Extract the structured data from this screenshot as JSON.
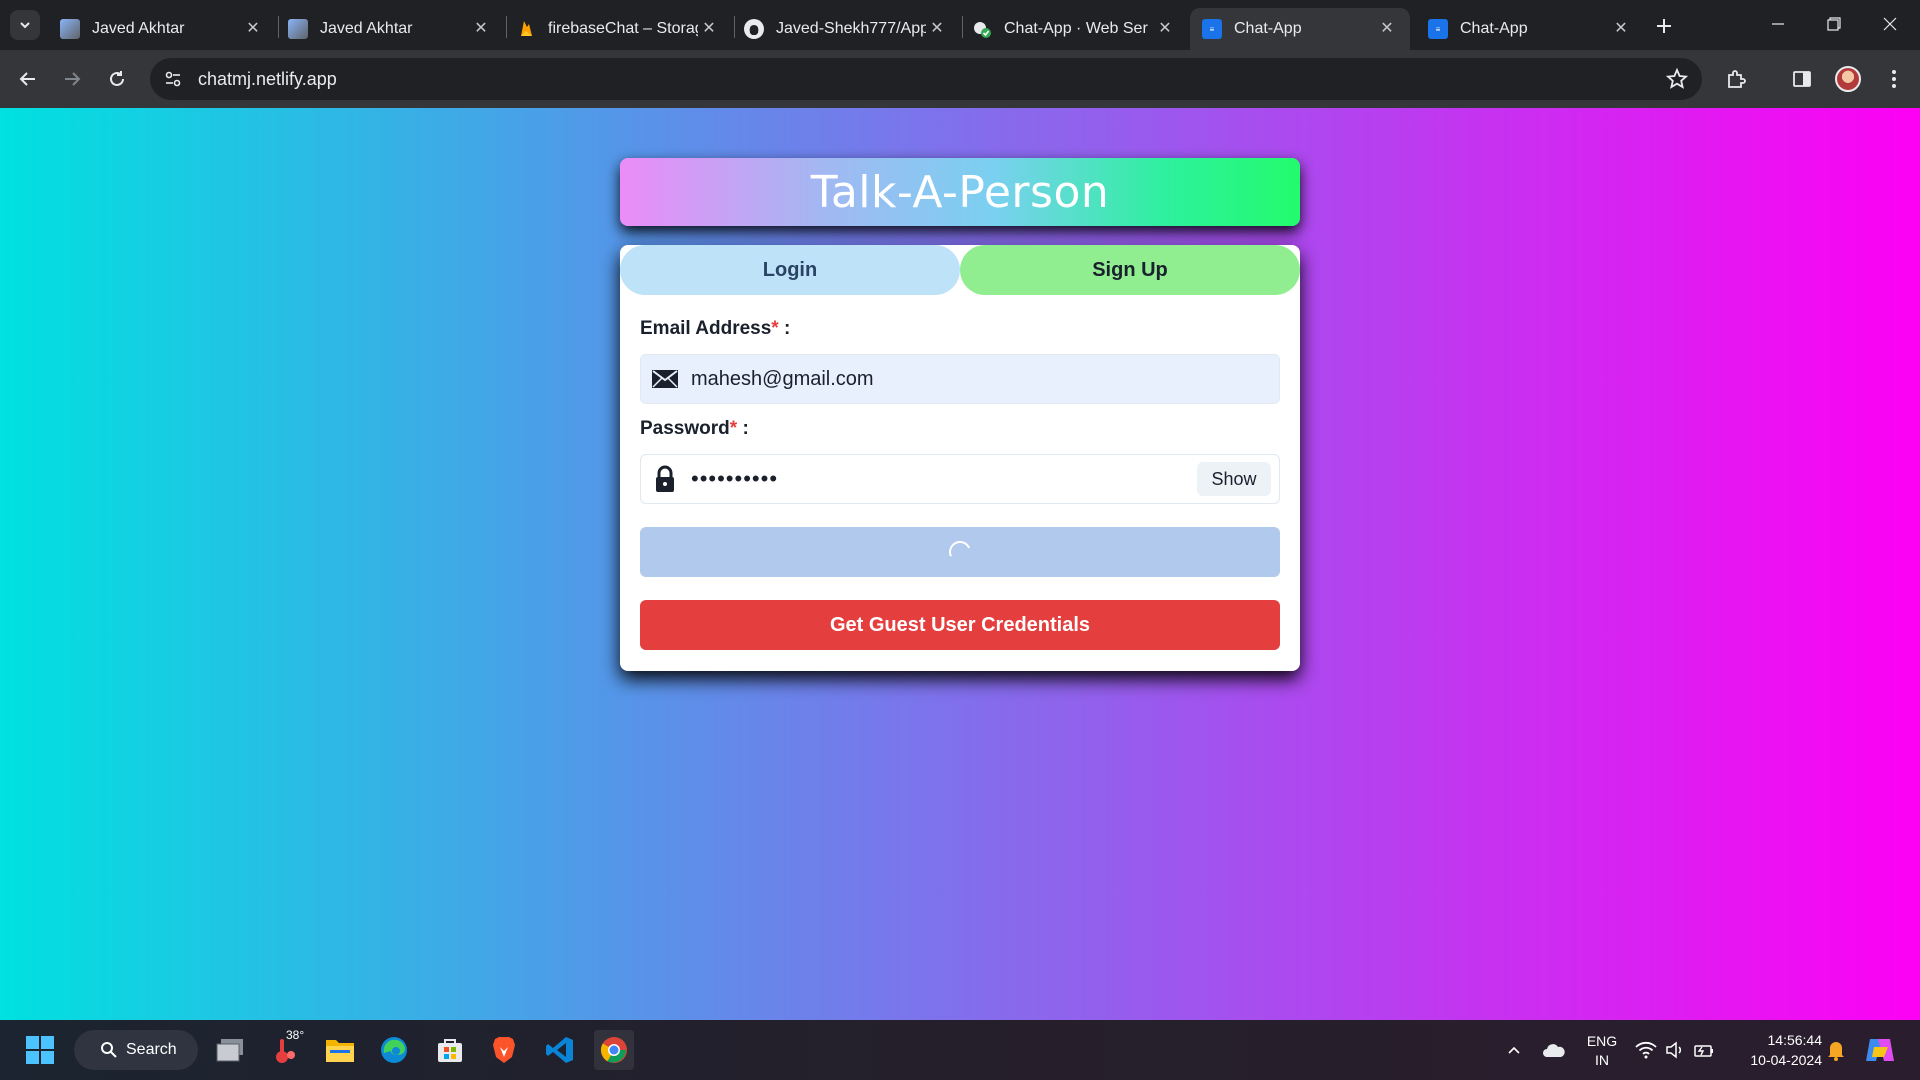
{
  "browser": {
    "tabs": [
      {
        "title": "Javed Akhtar",
        "favicon": "person-avatar-icon",
        "active": false
      },
      {
        "title": "Javed Akhtar",
        "favicon": "person-avatar-icon",
        "active": false
      },
      {
        "title": "firebaseChat – Storag",
        "favicon": "firebase-icon",
        "active": false
      },
      {
        "title": "Javed-Shekh777/App",
        "favicon": "github-icon",
        "active": false
      },
      {
        "title": "Chat-App · Web Ser",
        "favicon": "render-icon",
        "active": false
      },
      {
        "title": "Chat-App",
        "favicon": "chat-app-icon",
        "active": true
      },
      {
        "title": "Chat-App",
        "favicon": "chat-app-icon",
        "active": false
      }
    ],
    "url": "chatmj.netlify.app"
  },
  "app": {
    "title": "Talk-A-Person",
    "tabs": {
      "login": "Login",
      "signup": "Sign Up"
    },
    "email": {
      "label": "Email Address",
      "required_mark": "*",
      "suffix": " :",
      "value": "mahesh@gmail.com"
    },
    "password": {
      "label": "Password",
      "required_mark": "*",
      "suffix": " :",
      "value": "••••••••••",
      "toggle": "Show"
    },
    "submit": {
      "state": "loading"
    },
    "guest_button": "Get Guest User Credentials"
  },
  "taskbar": {
    "search_label": "Search",
    "weather_temp": "38°",
    "language": {
      "line1": "ENG",
      "line2": "IN"
    },
    "time": "14:56:44",
    "date": "10-04-2024"
  },
  "colors": {
    "page_gradient": [
      "#00e1e0",
      "#fe00f4"
    ],
    "login_tab": "#bee3f8",
    "signup_tab": "#90ee90",
    "guest_button": "#e53e3e",
    "submit_loading": "#b0c9ec"
  }
}
